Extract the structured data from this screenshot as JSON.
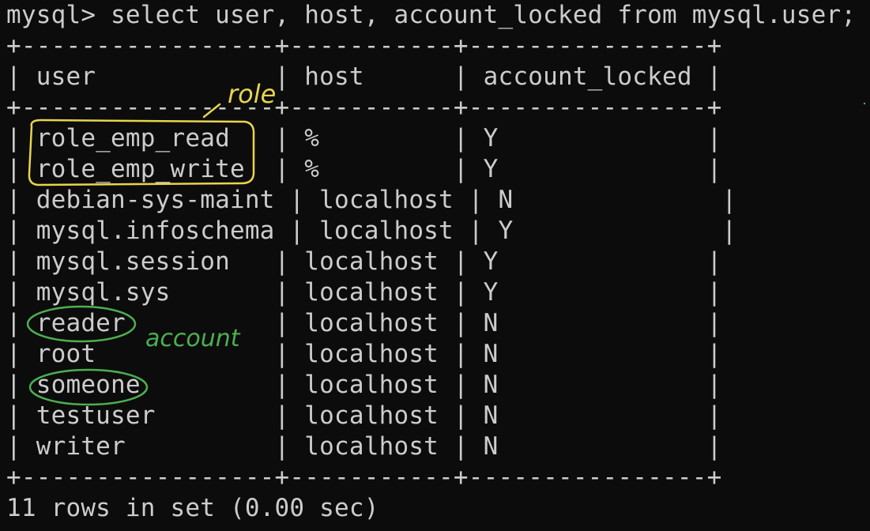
{
  "terminal": {
    "prompt": "mysql> ",
    "command": "select user, host, account_locked from mysql.user;",
    "border": "+-----------------+-----------+----------------+",
    "header_row": "| user            | host      | account_locked |",
    "rows": [
      "| role_emp_read   | %         | Y              |",
      "| role_emp_write  | %         | Y              |",
      "| debian-sys-maint | localhost | N              |",
      "| mysql.infoschema | localhost | Y              |",
      "| mysql.session   | localhost | Y              |",
      "| mysql.sys       | localhost | Y              |",
      "| reader          | localhost | N              |",
      "| root            | localhost | N              |",
      "| someone         | localhost | N              |",
      "| testuser        | localhost | N              |",
      "| writer          | localhost | N              |"
    ],
    "summary": "11 rows in set (0.00 sec)"
  },
  "annotations": {
    "role_label": "role",
    "account_label": "account",
    "role_color": "#e8d44d",
    "account_color": "#4caf50"
  }
}
